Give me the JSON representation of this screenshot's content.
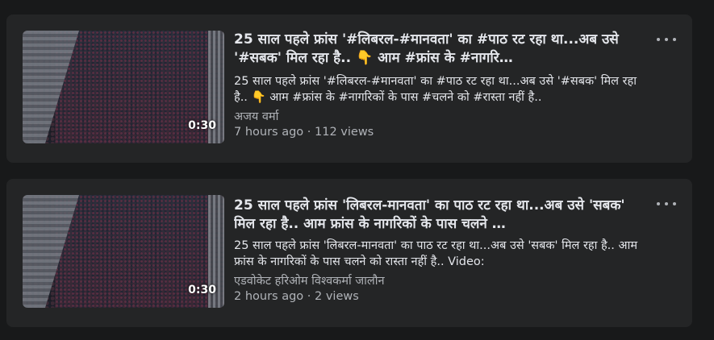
{
  "videos": [
    {
      "title": "25 साल पहले फ्रांस '#लिबरल-#मानवता' का #पाठ रट रहा था...अब उसे '#सबक' मिल रहा है.. 👇 आम #फ्रांस के #नागरि…",
      "description": "25 साल पहले फ्रांस '#लिबरल-#मानवता' का #पाठ रट रहा था...अब उसे '#सबक' मिल रहा है.. 👇 आम #फ्रांस के #नागरिकों के पास #चलने को #रास्ता नहीं है..",
      "author": "अजय वर्मा",
      "meta": "7 hours ago · 112 views",
      "duration": "0:30",
      "thumbnail_icon": "crowd-street-thumbnail"
    },
    {
      "title": "25 साल पहले फ्रांस 'लिबरल-मानवता' का पाठ रट रहा था...अब उसे 'सबक' मिल रहा है.. आम फ्रांस के नागरिकों के पास चलने …",
      "description": "25 साल पहले फ्रांस 'लिबरल-मानवता' का पाठ रट रहा था...अब उसे 'सबक' मिल रहा है.. आम फ्रांस के नागरिकों के पास चलने को रास्ता नहीं है.. Video:",
      "author": "एडवोकेट हरिओम विश्वकर्मा जालौन",
      "meta": "2 hours ago · 2 views",
      "duration": "0:30",
      "thumbnail_icon": "crowd-street-thumbnail"
    }
  ],
  "more_icon": "more-horizontal-icon",
  "colors": {
    "background": "#18191a",
    "card": "#242526",
    "text_primary": "#e4e6eb",
    "text_secondary": "#b0b3b8"
  }
}
